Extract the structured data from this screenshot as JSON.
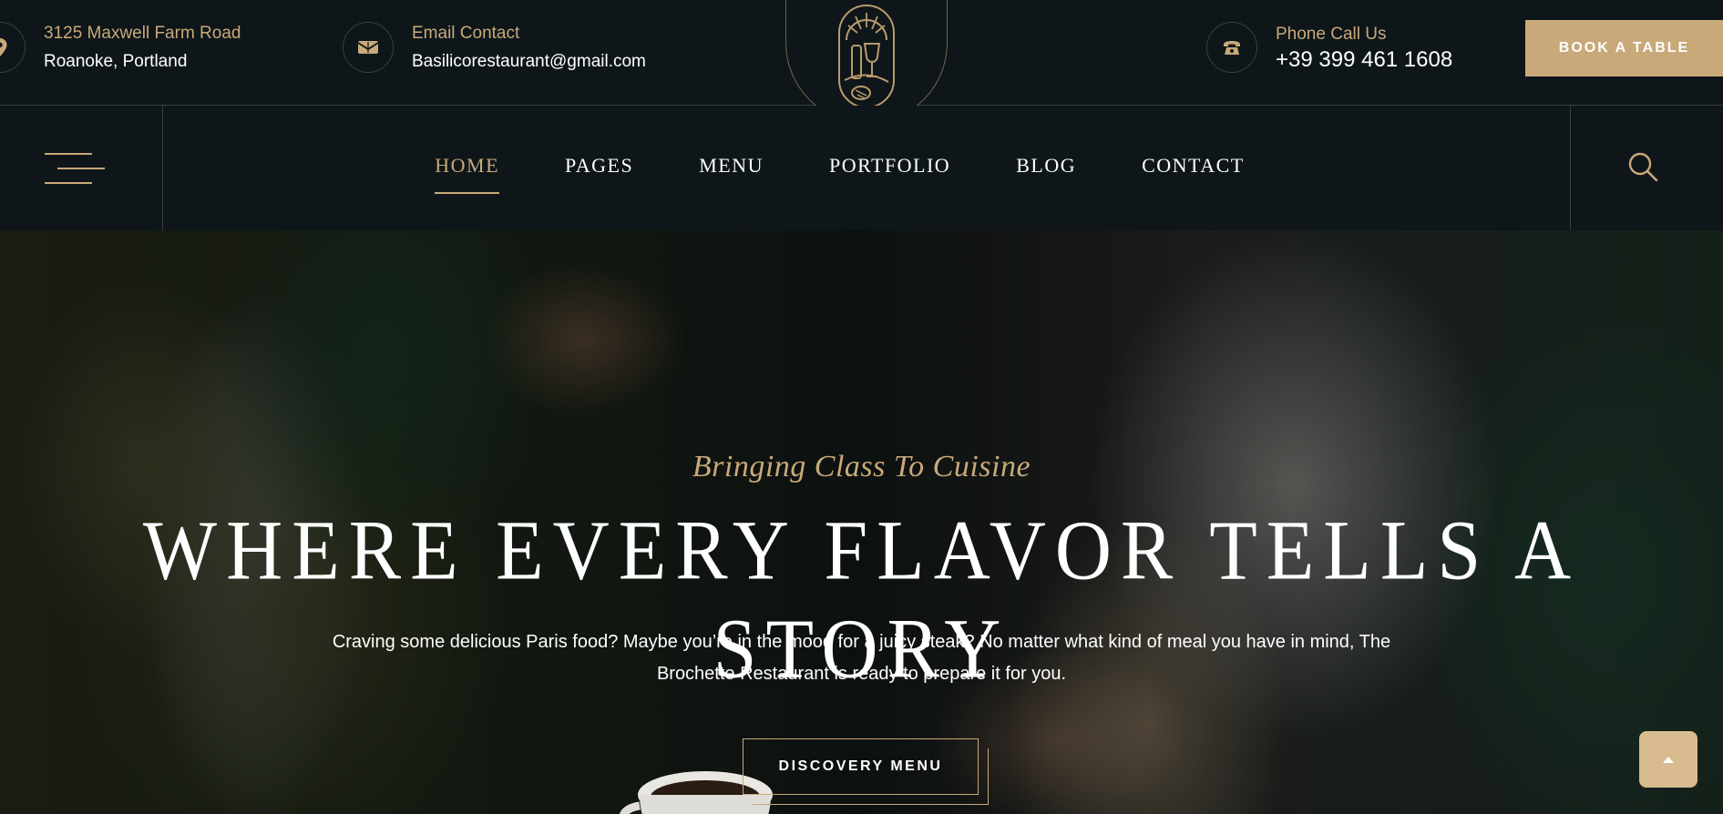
{
  "topbar": {
    "address": {
      "label": "3125 Maxwell Farm Road",
      "value": "Roanoke, Portland",
      "icon": "map-pin-icon"
    },
    "email": {
      "label": "Email Contact",
      "value": "Basilicorestaurant@gmail.com",
      "icon": "envelope-icon"
    },
    "phone": {
      "label": "Phone Call Us",
      "value": "+39 399 461 1608",
      "icon": "phone-icon"
    },
    "book_button": "BOOK A TABLE"
  },
  "nav": {
    "items": [
      {
        "label": "HOME",
        "active": true
      },
      {
        "label": "PAGES"
      },
      {
        "label": "MENU"
      },
      {
        "label": "PORTFOLIO"
      },
      {
        "label": "BLOG"
      },
      {
        "label": "CONTACT"
      }
    ]
  },
  "hero": {
    "tagline": "Bringing Class To Cuisine",
    "headline": "WHERE EVERY FLAVOR TELLS A STORY",
    "description": "Craving some delicious Paris food? Maybe you’re in the mood for a juicy steak? No matter what kind of meal you have in mind, The Brochette Restaurant is ready to prepare it for you.",
    "cta": "DISCOVERY MENU"
  },
  "colors": {
    "accent": "#c9a97a",
    "background": "#0e1619"
  }
}
